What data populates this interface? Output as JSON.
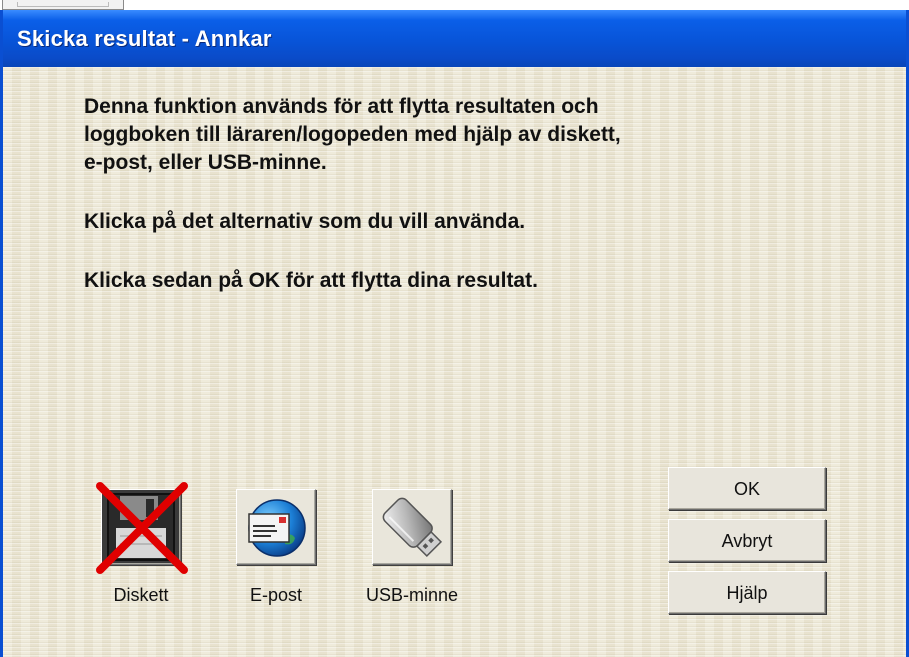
{
  "window": {
    "title": "Skicka resultat - Annkar"
  },
  "message": {
    "line1": "Denna funktion används för att flytta resultaten och",
    "line2": "loggboken till läraren/logopeden med hjälp av diskett,",
    "line3": "e-post, eller USB-minne.",
    "instruction1": "Klicka på det alternativ som du vill använda.",
    "instruction2": "Klicka sedan på OK för att flytta dina resultat."
  },
  "options": [
    {
      "label": "Diskett",
      "icon": "floppy-disk-icon",
      "disabled": true
    },
    {
      "label": "E-post",
      "icon": "email-globe-icon",
      "disabled": false
    },
    {
      "label": "USB-minne",
      "icon": "usb-drive-icon",
      "disabled": false
    }
  ],
  "buttons": {
    "ok": "OK",
    "cancel": "Avbryt",
    "help": "Hjälp"
  },
  "colors": {
    "titlebar": "#0854d8",
    "background": "#ece9d8",
    "disabled_cross": "#e00000"
  }
}
